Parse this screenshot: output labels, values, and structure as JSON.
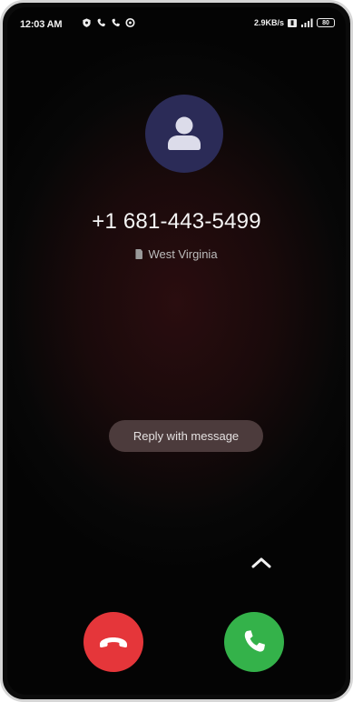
{
  "status_bar": {
    "time": "12:03 AM",
    "left_icons": [
      "shield-icon",
      "phone-icon",
      "phone-icon",
      "record-icon"
    ],
    "network_speed": "2.9KB/s",
    "signal": "signal-icon",
    "battery": "80"
  },
  "caller": {
    "number": "+1 681-443-5499",
    "location": "West Virginia",
    "avatar_icon": "person-icon"
  },
  "actions": {
    "reply_label": "Reply with message",
    "swipe_up_icon": "chevron-up-icon",
    "decline_icon": "phone-hangup-icon",
    "accept_icon": "phone-icon"
  },
  "colors": {
    "decline": "#e5363a",
    "accept": "#34b24a",
    "avatar_bg": "#2b2b57"
  }
}
